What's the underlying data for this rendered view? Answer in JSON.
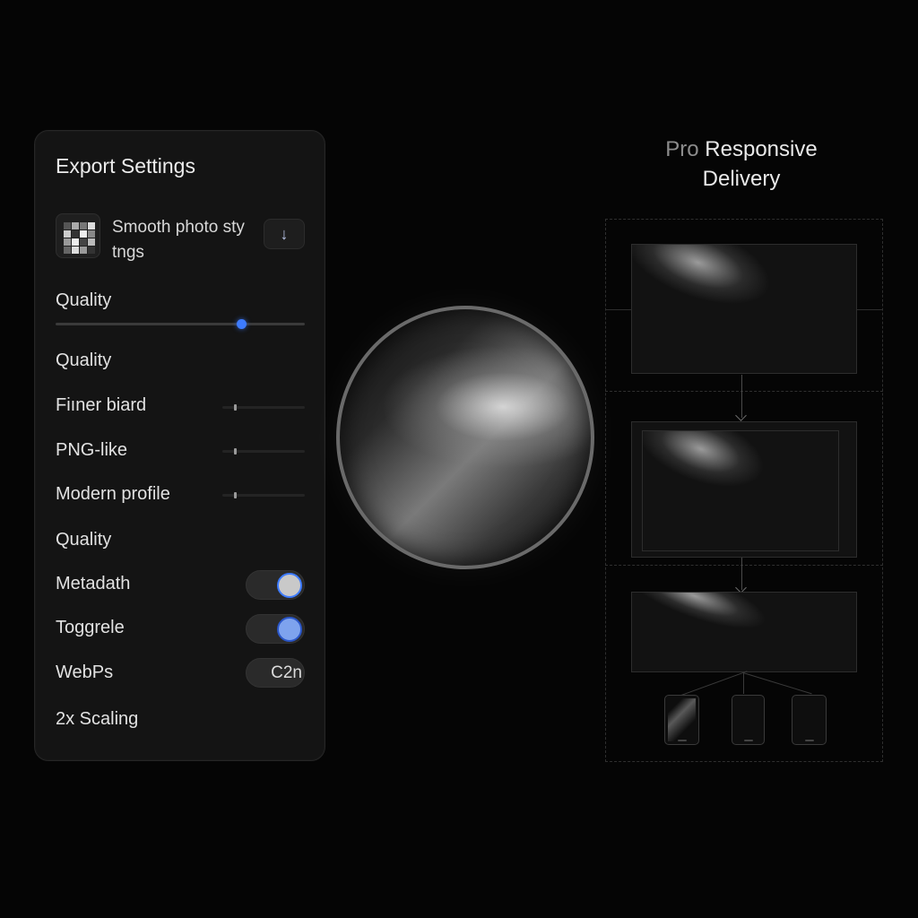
{
  "panel": {
    "title": "Export Settings",
    "preset": {
      "name": "Smooth photo sty tngs",
      "button_icon": "download-arrow-icon",
      "button_glyph": "↓"
    },
    "rows": [
      {
        "id": "quality-main",
        "label": "Quality",
        "control": "slider",
        "value": 0.68
      },
      {
        "id": "quality-2",
        "label": "Quality"
      },
      {
        "id": "filter",
        "label": "Fiıner biard",
        "control": "mini-slider",
        "value": 0.15
      },
      {
        "id": "png",
        "label": "PNG-like",
        "control": "mini-slider",
        "value": 0.15
      },
      {
        "id": "modern",
        "label": "Modern profile",
        "control": "mini-slider",
        "value": 0.15
      },
      {
        "id": "quality-3",
        "label": "Quality"
      },
      {
        "id": "metadata",
        "label": "Metadath",
        "control": "toggle",
        "on": true
      },
      {
        "id": "toggle",
        "label": "Toggrele",
        "control": "toggle",
        "on": true
      },
      {
        "id": "webp",
        "label": "WebPs",
        "control": "pill",
        "value": "C2n"
      },
      {
        "id": "scaling",
        "label": "2x Scaling"
      }
    ]
  },
  "right": {
    "title_prefix": "Pro",
    "title_rest": " Responsive Delivery"
  },
  "colors": {
    "accent": "#3d7bff",
    "background": "#050505",
    "panel": "#141414"
  }
}
